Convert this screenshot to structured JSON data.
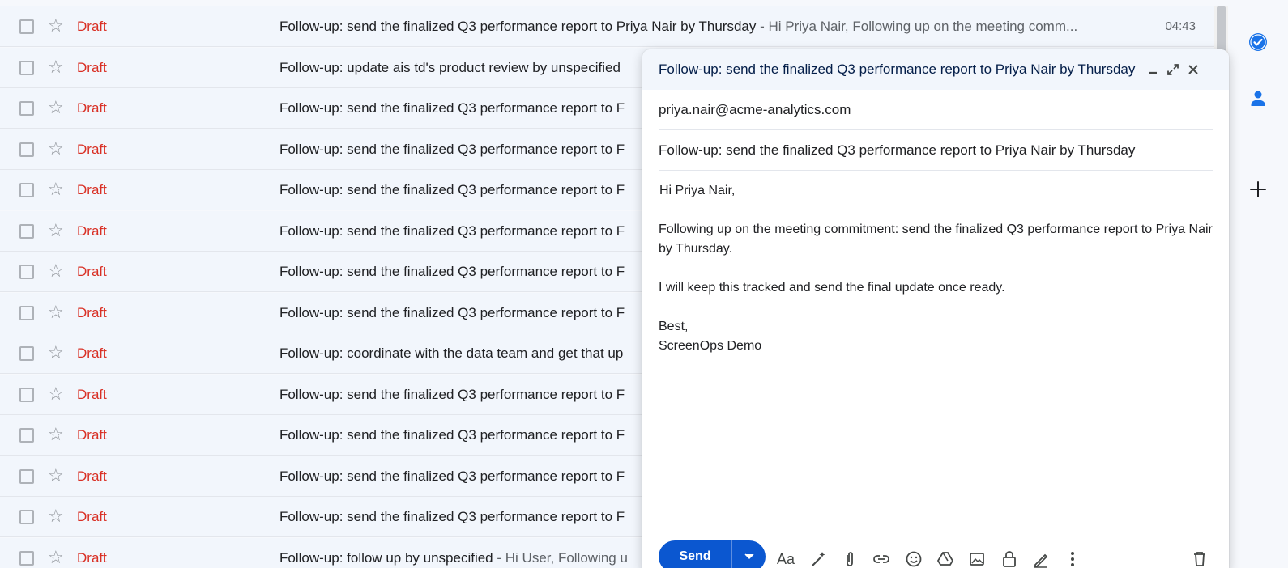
{
  "email_list": {
    "rows": [
      {
        "sender": "Draft",
        "subject": "Follow-up: send the finalized Q3 performance report to Priya Nair by Thursday",
        "snippet": " - Hi Priya Nair, Following up on the meeting comm...",
        "time": "04:43"
      },
      {
        "sender": "Draft",
        "subject": "Follow-up: update ais td's product review by unspecified",
        "snippet": "",
        "time": ""
      },
      {
        "sender": "Draft",
        "subject": "Follow-up: send the finalized Q3 performance report to F",
        "snippet": "",
        "time": ""
      },
      {
        "sender": "Draft",
        "subject": "Follow-up: send the finalized Q3 performance report to F",
        "snippet": "",
        "time": ""
      },
      {
        "sender": "Draft",
        "subject": "Follow-up: send the finalized Q3 performance report to F",
        "snippet": "",
        "time": ""
      },
      {
        "sender": "Draft",
        "subject": "Follow-up: send the finalized Q3 performance report to F",
        "snippet": "",
        "time": ""
      },
      {
        "sender": "Draft",
        "subject": "Follow-up: send the finalized Q3 performance report to F",
        "snippet": "",
        "time": ""
      },
      {
        "sender": "Draft",
        "subject": "Follow-up: send the finalized Q3 performance report to F",
        "snippet": "",
        "time": ""
      },
      {
        "sender": "Draft",
        "subject": "Follow-up: coordinate with the data team and get that up",
        "snippet": "",
        "time": ""
      },
      {
        "sender": "Draft",
        "subject": "Follow-up: send the finalized Q3 performance report to F",
        "snippet": "",
        "time": ""
      },
      {
        "sender": "Draft",
        "subject": "Follow-up: send the finalized Q3 performance report to F",
        "snippet": "",
        "time": ""
      },
      {
        "sender": "Draft",
        "subject": "Follow-up: send the finalized Q3 performance report to F",
        "snippet": "",
        "time": ""
      },
      {
        "sender": "Draft",
        "subject": "Follow-up: send the finalized Q3 performance report to F",
        "snippet": "",
        "time": ""
      },
      {
        "sender": "Draft",
        "subject": "Follow-up: follow up by unspecified",
        "snippet": " - Hi User, Following u",
        "time": ""
      }
    ]
  },
  "compose": {
    "title": "Follow-up: send the finalized Q3 performance report to Priya Nair by Thursday",
    "to": "priya.nair@acme-analytics.com",
    "subject": "Follow-up: send the finalized Q3 performance report to Priya Nair by Thursday",
    "body": {
      "greeting": "Hi Priya Nair,",
      "paragraph1": "Following up on the meeting commitment: send the finalized Q3 performance report to Priya Nair by Thursday.",
      "paragraph2": "I will keep this tracked and send the final update once ready.",
      "signoff": "Best,",
      "signature": "ScreenOps Demo"
    },
    "send_label": "Send",
    "formatting_label": "Aa"
  },
  "side_panel": {
    "icons": [
      "tasks-icon",
      "contacts-icon",
      "add-icon"
    ]
  },
  "colors": {
    "accent": "#0b57d0",
    "draft_label": "#d93025",
    "list_background": "#f2f6fc"
  }
}
